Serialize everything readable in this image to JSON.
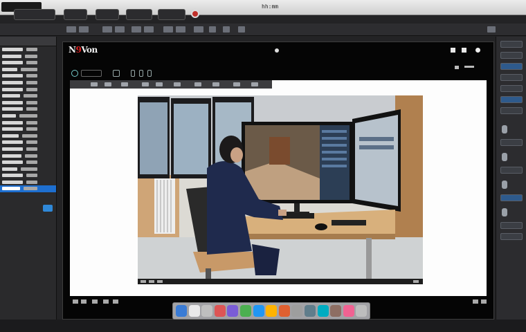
{
  "menubar": {
    "app_label": "",
    "clock": "hh:mm"
  },
  "window": {
    "title_part1": "N",
    "title_accent": "9",
    "title_part2": "Von"
  },
  "colors": {
    "menubar": "#dcdcdc",
    "selection": "#1e6fd0",
    "record": "#c0302b",
    "canvas": "#fdfdfd",
    "window_bg": "#050505"
  },
  "icons": {
    "toolbar": [
      "tool-icon",
      "tool-icon",
      "tool-icon",
      "tool-icon",
      "tool-icon",
      "tool-icon"
    ],
    "record": "record-icon",
    "window_controls": [
      "fullscreen-icon",
      "settings-icon",
      "close-icon"
    ],
    "dock": [
      "finder-icon",
      "app-icon",
      "app-icon",
      "app-icon",
      "safari-icon",
      "app-icon",
      "app-icon",
      "app-icon",
      "app-icon",
      "app-icon",
      "app-icon",
      "app-icon",
      "app-icon",
      "app-icon",
      "trash-icon"
    ]
  }
}
